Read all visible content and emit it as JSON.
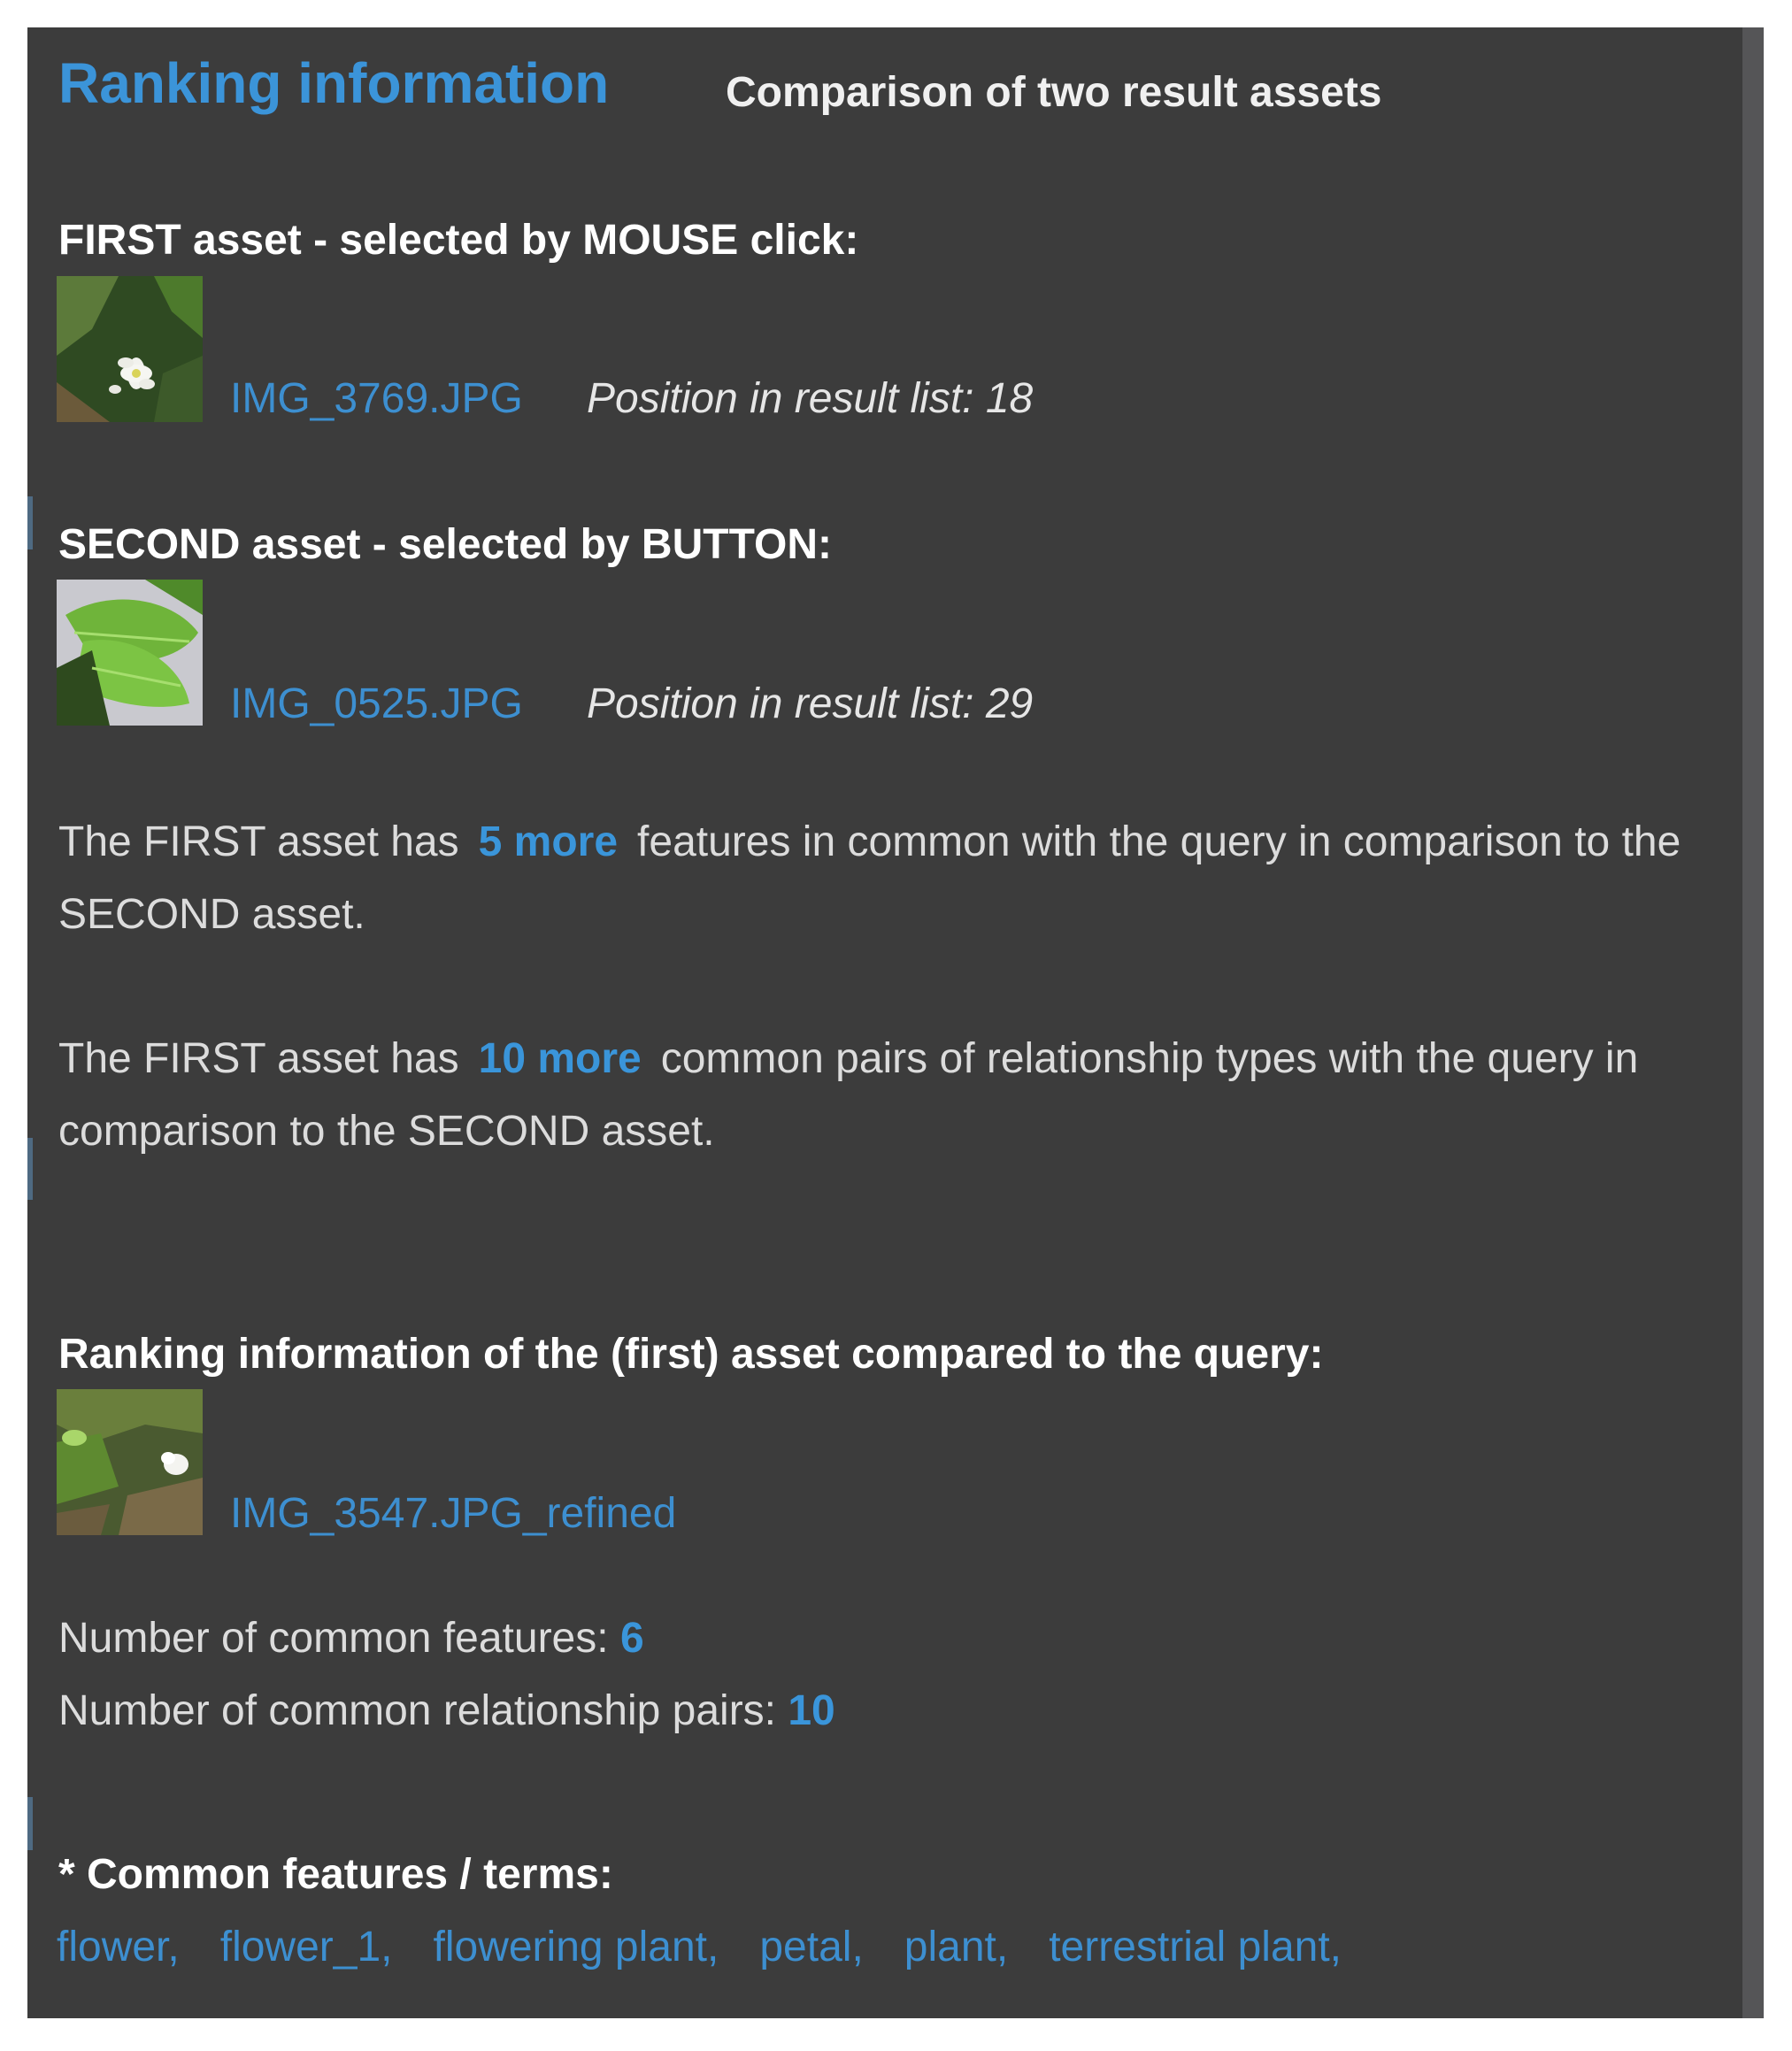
{
  "header": {
    "title": "Ranking information",
    "subtitle": "Comparison of two result assets"
  },
  "first_asset": {
    "heading": "FIRST asset - selected by MOUSE click:",
    "filename": "IMG_3769.JPG",
    "position_text": "Position in result list: 18",
    "thumbnail_icon": "white-flower-photo"
  },
  "second_asset": {
    "heading": "SECOND asset - selected by BUTTON:",
    "filename": "IMG_0525.JPG",
    "position_text": "Position in result list: 29",
    "thumbnail_icon": "green-leaves-photo"
  },
  "comparison": {
    "features": {
      "prefix": "The FIRST asset has",
      "value": "5 more",
      "suffix": "features in common with the query in comparison to the SECOND asset."
    },
    "relationships": {
      "prefix": "The FIRST asset has",
      "value": "10 more",
      "suffix": "common pairs of relationship types with the query in comparison to the SECOND asset."
    }
  },
  "ranking": {
    "heading": "Ranking information of the (first) asset compared to the query:",
    "filename": "IMG_3547.JPG_refined",
    "thumbnail_icon": "garden-plant-photo",
    "common_features_label": "Number of common features:",
    "common_features_value": "6",
    "common_pairs_label": "Number of common relationship pairs:",
    "common_pairs_value": "10"
  },
  "common_terms": {
    "heading": "* Common features / terms:",
    "items": [
      "flower,",
      "flower_1,",
      "flowering plant,",
      "petal,",
      "plant,",
      "terrestrial plant,"
    ]
  },
  "colors": {
    "panel_background": "#3c3c3c",
    "accent_blue": "#3b94d9",
    "text_light": "#dcdcdc"
  }
}
